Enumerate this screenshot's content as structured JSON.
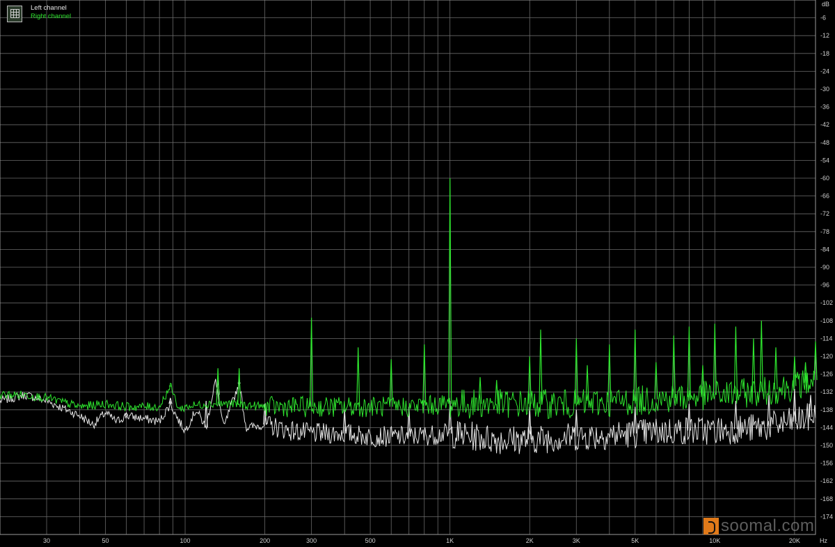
{
  "chart_data": {
    "type": "line",
    "x_scale": "log",
    "x_unit": "Hz",
    "y_unit": "dB",
    "xlim": [
      20,
      24000
    ],
    "ylim": [
      -180,
      0
    ],
    "x_ticks": [
      {
        "v": 30,
        "label": "30"
      },
      {
        "v": 50,
        "label": "50"
      },
      {
        "v": 100,
        "label": "100"
      },
      {
        "v": 200,
        "label": "200"
      },
      {
        "v": 300,
        "label": "300"
      },
      {
        "v": 500,
        "label": "500"
      },
      {
        "v": 1000,
        "label": "1K"
      },
      {
        "v": 2000,
        "label": "2K"
      },
      {
        "v": 3000,
        "label": "3K"
      },
      {
        "v": 5000,
        "label": "5K"
      },
      {
        "v": 10000,
        "label": "10K"
      },
      {
        "v": 20000,
        "label": "20K"
      }
    ],
    "y_ticks": [
      -6,
      -12,
      -18,
      -24,
      -30,
      -36,
      -42,
      -48,
      -54,
      -60,
      -66,
      -72,
      -78,
      -84,
      -90,
      -96,
      -102,
      -108,
      -114,
      -120,
      -126,
      -132,
      -138,
      -144,
      -150,
      -156,
      -162,
      -168,
      -174
    ],
    "legend": {
      "position": "top-left",
      "entries": [
        "Left channel",
        "Right channel"
      ]
    },
    "grid": true,
    "series": [
      {
        "name": "Left channel",
        "color": "#e6e6e6",
        "points": [
          [
            20,
            -135
          ],
          [
            25,
            -133
          ],
          [
            30,
            -135
          ],
          [
            40,
            -140
          ],
          [
            45,
            -143
          ],
          [
            50,
            -139
          ],
          [
            55,
            -142
          ],
          [
            60,
            -140
          ],
          [
            70,
            -141
          ],
          [
            80,
            -142
          ],
          [
            88,
            -136
          ],
          [
            95,
            -142
          ],
          [
            100,
            -145
          ],
          [
            110,
            -138
          ],
          [
            120,
            -144
          ],
          [
            130,
            -128
          ],
          [
            140,
            -144
          ],
          [
            150,
            -136
          ],
          [
            160,
            -129
          ],
          [
            170,
            -144
          ],
          [
            200,
            -143
          ],
          [
            250,
            -145
          ],
          [
            300,
            -146
          ],
          [
            400,
            -146
          ],
          [
            500,
            -147
          ],
          [
            700,
            -147
          ],
          [
            1000,
            -146
          ],
          [
            1500,
            -148
          ],
          [
            2000,
            -148
          ],
          [
            3000,
            -147
          ],
          [
            5000,
            -146
          ],
          [
            7000,
            -145
          ],
          [
            10000,
            -145
          ],
          [
            15000,
            -144
          ],
          [
            20000,
            -142
          ],
          [
            24000,
            -140
          ]
        ],
        "spikes": [
          [
            60,
            -139
          ],
          [
            88,
            -134
          ],
          [
            120,
            -135
          ],
          [
            133,
            -128
          ],
          [
            160,
            -129
          ],
          [
            200,
            -136
          ],
          [
            400,
            -138
          ],
          [
            700,
            -137
          ],
          [
            1000,
            -135
          ],
          [
            2000,
            -137
          ],
          [
            3000,
            -138
          ],
          [
            5000,
            -137
          ],
          [
            8000,
            -136
          ],
          [
            12000,
            -135
          ],
          [
            16000,
            -133
          ],
          [
            20000,
            -131
          ],
          [
            23000,
            -133
          ]
        ]
      },
      {
        "name": "Right channel",
        "color": "#2ee52e",
        "points": [
          [
            20,
            -133
          ],
          [
            25,
            -133
          ],
          [
            30,
            -134
          ],
          [
            40,
            -137
          ],
          [
            50,
            -136
          ],
          [
            60,
            -137
          ],
          [
            70,
            -137
          ],
          [
            80,
            -137
          ],
          [
            88,
            -130
          ],
          [
            95,
            -138
          ],
          [
            100,
            -137
          ],
          [
            120,
            -136
          ],
          [
            150,
            -136
          ],
          [
            200,
            -137
          ],
          [
            300,
            -137
          ],
          [
            500,
            -137
          ],
          [
            700,
            -137
          ],
          [
            1000,
            -136
          ],
          [
            1500,
            -136
          ],
          [
            2000,
            -136
          ],
          [
            3000,
            -136
          ],
          [
            5000,
            -135
          ],
          [
            7000,
            -134
          ],
          [
            10000,
            -133
          ],
          [
            15000,
            -132
          ],
          [
            20000,
            -130
          ],
          [
            24000,
            -128
          ]
        ],
        "spikes": [
          [
            88,
            -130
          ],
          [
            133,
            -124
          ],
          [
            160,
            -124
          ],
          [
            300,
            -107
          ],
          [
            450,
            -117
          ],
          [
            600,
            -121
          ],
          [
            800,
            -116
          ],
          [
            1000,
            -60
          ],
          [
            1300,
            -127
          ],
          [
            1500,
            -128
          ],
          [
            2000,
            -120
          ],
          [
            2200,
            -111
          ],
          [
            3000,
            -114
          ],
          [
            3300,
            -123
          ],
          [
            4000,
            -116
          ],
          [
            5000,
            -111
          ],
          [
            6000,
            -122
          ],
          [
            7000,
            -113
          ],
          [
            8000,
            -110
          ],
          [
            9000,
            -123
          ],
          [
            10000,
            -109
          ],
          [
            12000,
            -110
          ],
          [
            14000,
            -114
          ],
          [
            15000,
            -108
          ],
          [
            17000,
            -117
          ],
          [
            20000,
            -120
          ],
          [
            22000,
            -122
          ],
          [
            24000,
            -115
          ]
        ]
      }
    ]
  },
  "watermark": {
    "text": "soomal.com"
  },
  "legend_icon": "grid-icon"
}
